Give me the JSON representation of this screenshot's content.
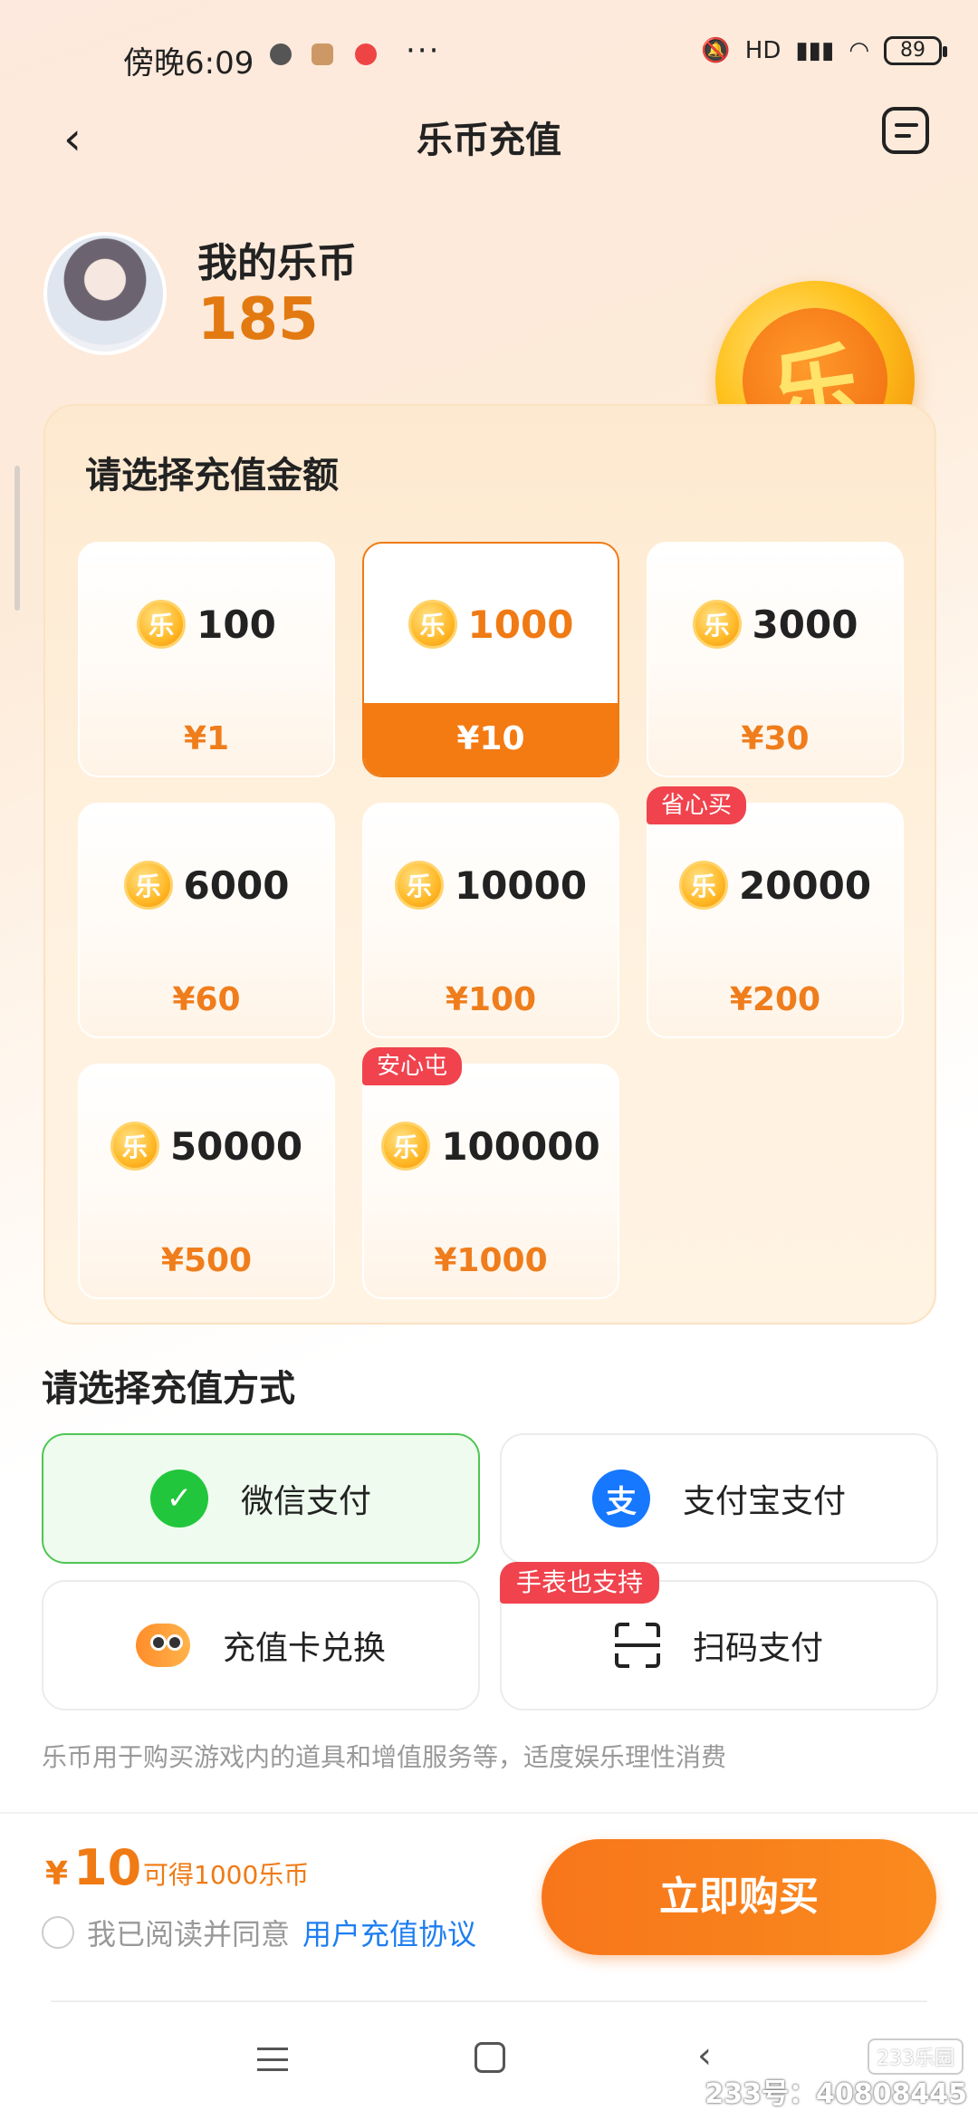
{
  "status_bar": {
    "time": "傍晚6:09",
    "dots": "···",
    "network": "HD",
    "battery": "89"
  },
  "header": {
    "title": "乐币充值",
    "back_icon": "chevron-left-icon",
    "menu_icon": "list-icon"
  },
  "account": {
    "label": "我的乐币",
    "balance": "185",
    "coin_char": "乐"
  },
  "recharge": {
    "title": "请选择充值金额",
    "options": [
      {
        "coins": "100",
        "price": "¥1",
        "selected": false,
        "tag": ""
      },
      {
        "coins": "1000",
        "price": "¥10",
        "selected": true,
        "tag": ""
      },
      {
        "coins": "3000",
        "price": "¥30",
        "selected": false,
        "tag": ""
      },
      {
        "coins": "6000",
        "price": "¥60",
        "selected": false,
        "tag": ""
      },
      {
        "coins": "10000",
        "price": "¥100",
        "selected": false,
        "tag": ""
      },
      {
        "coins": "20000",
        "price": "¥200",
        "selected": false,
        "tag": "省心买"
      },
      {
        "coins": "50000",
        "price": "¥500",
        "selected": false,
        "tag": ""
      },
      {
        "coins": "100000",
        "price": "¥1000",
        "selected": false,
        "tag": "安心屯"
      }
    ]
  },
  "payment": {
    "title": "请选择充值方式",
    "methods": [
      {
        "label": "微信支付",
        "icon": "wechat-pay-icon",
        "selected": true,
        "tag": ""
      },
      {
        "label": "支付宝支付",
        "icon": "alipay-icon",
        "selected": false,
        "tag": ""
      },
      {
        "label": "充值卡兑换",
        "icon": "recharge-card-icon",
        "selected": false,
        "tag": ""
      },
      {
        "label": "扫码支付",
        "icon": "scan-icon",
        "selected": false,
        "tag": "手表也支持"
      }
    ],
    "note": "乐币用于购买游戏内的道具和增值服务等，适度娱乐理性消费"
  },
  "summary": {
    "currency": "¥",
    "amount": "10",
    "get_text": "可得1000乐币",
    "agree_text": "我已阅读并同意",
    "agreement_link": "用户充值协议",
    "buy_button": "立即购买"
  },
  "watermark": {
    "logo": "233乐园",
    "id_text": "233号：40808445"
  },
  "colors": {
    "accent": "#f47a12",
    "tag_red": "#f0434e",
    "wechat_green": "#22c63c",
    "alipay_blue": "#1677ff",
    "link_blue": "#1e7ef0"
  }
}
